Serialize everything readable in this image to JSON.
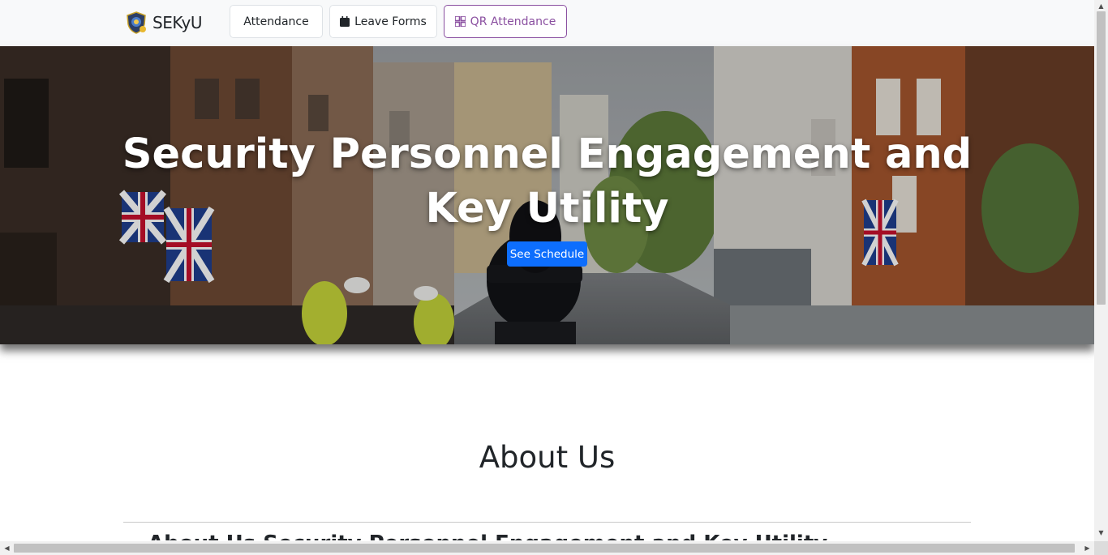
{
  "navbar": {
    "brand": "SEKyU",
    "buttons": {
      "attendance": "Attendance",
      "leave_forms": "Leave Forms",
      "qr_attendance": "QR Attendance"
    },
    "accent_color": "#8a4fa0"
  },
  "hero": {
    "title": "Security Personnel Engagement and Key Utility",
    "cta_label": "See Schedule",
    "cta_color": "#0d6efd"
  },
  "about": {
    "heading": "About Us",
    "subheading": "About Us Security Personnel Engagement and Key Utility"
  },
  "icons": {
    "leave_forms": "calendar-icon",
    "qr_attendance": "grid-icon",
    "scroll_up": "arrow-up-icon",
    "scroll_down": "arrow-down-icon",
    "scroll_left": "arrow-left-icon",
    "scroll_right": "arrow-right-icon"
  }
}
